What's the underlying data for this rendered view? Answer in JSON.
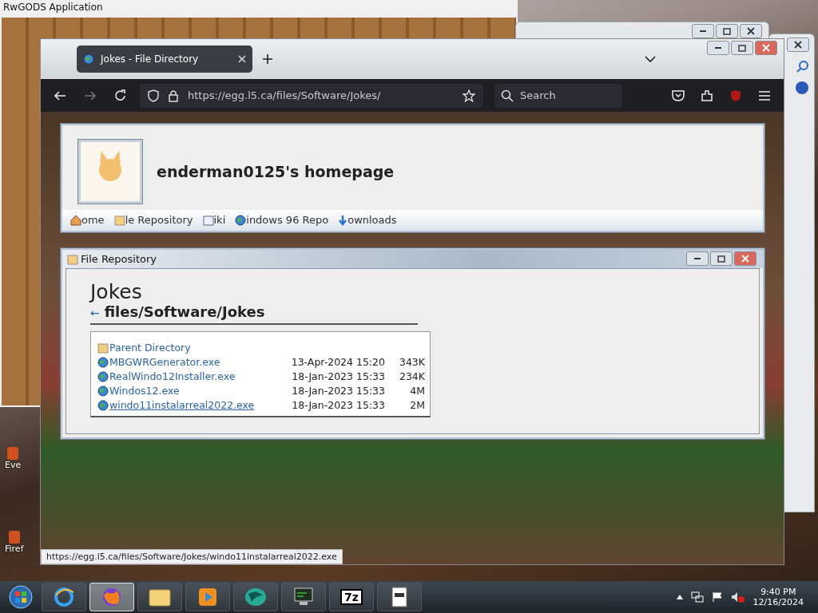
{
  "background_window": {
    "title": "RwGODS Application"
  },
  "desktop_icons": [
    {
      "label": "Eve"
    },
    {
      "label": "Firef"
    }
  ],
  "browser": {
    "tabs": [
      {
        "label": "Jokes - File Directory",
        "selected": true
      }
    ],
    "url": "https://egg.l5.ca/files/Software/Jokes/",
    "search": {
      "placeholder": "Search"
    },
    "status_url": "https://egg.l5.ca/files/Software/Jokes/windo11instalarreal2022.exe",
    "page": {
      "site_title": "enderman0125's homepage",
      "nav": [
        {
          "kind": "home",
          "label": "ome"
        },
        {
          "kind": "folder",
          "label": "le Repository"
        },
        {
          "kind": "book",
          "label": "iki"
        },
        {
          "kind": "globe",
          "label": "indows 96 Repo"
        },
        {
          "kind": "download",
          "label": "ownloads"
        }
      ],
      "window": {
        "title": "File Repository"
      },
      "heading": "Jokes",
      "path_arrow": "←",
      "path": "files/Software/Jokes",
      "listing": [
        {
          "kind": "parent",
          "name": "Parent Directory",
          "hovered": false
        },
        {
          "kind": "file",
          "name": "MBGWRGenerator.exe",
          "date": "13-Apr-2024 15:20",
          "size": "343K",
          "hovered": false
        },
        {
          "kind": "file",
          "name": "RealWindo12Installer.exe",
          "date": "18-Jan-2023 15:33",
          "size": "234K",
          "hovered": false
        },
        {
          "kind": "file",
          "name": "Windos12.exe",
          "date": "18-Jan-2023 15:33",
          "size": "4M",
          "hovered": false
        },
        {
          "kind": "file",
          "name": "windo11instalarreal2022.exe",
          "date": "18-Jan-2023 15:33",
          "size": "2M",
          "hovered": true
        }
      ]
    }
  },
  "taskbar": {
    "apps": [
      {
        "kind": "ie",
        "selected": false
      },
      {
        "kind": "firefox",
        "selected": true
      },
      {
        "kind": "folder",
        "selected": false
      },
      {
        "kind": "media",
        "selected": false
      },
      {
        "kind": "teal",
        "selected": false
      },
      {
        "kind": "monitor",
        "selected": false
      },
      {
        "kind": "archive",
        "selected": false,
        "label": "7z"
      },
      {
        "kind": "document",
        "selected": false
      }
    ],
    "clock": {
      "time": "9:40 PM",
      "date": "12/16/2024"
    }
  }
}
